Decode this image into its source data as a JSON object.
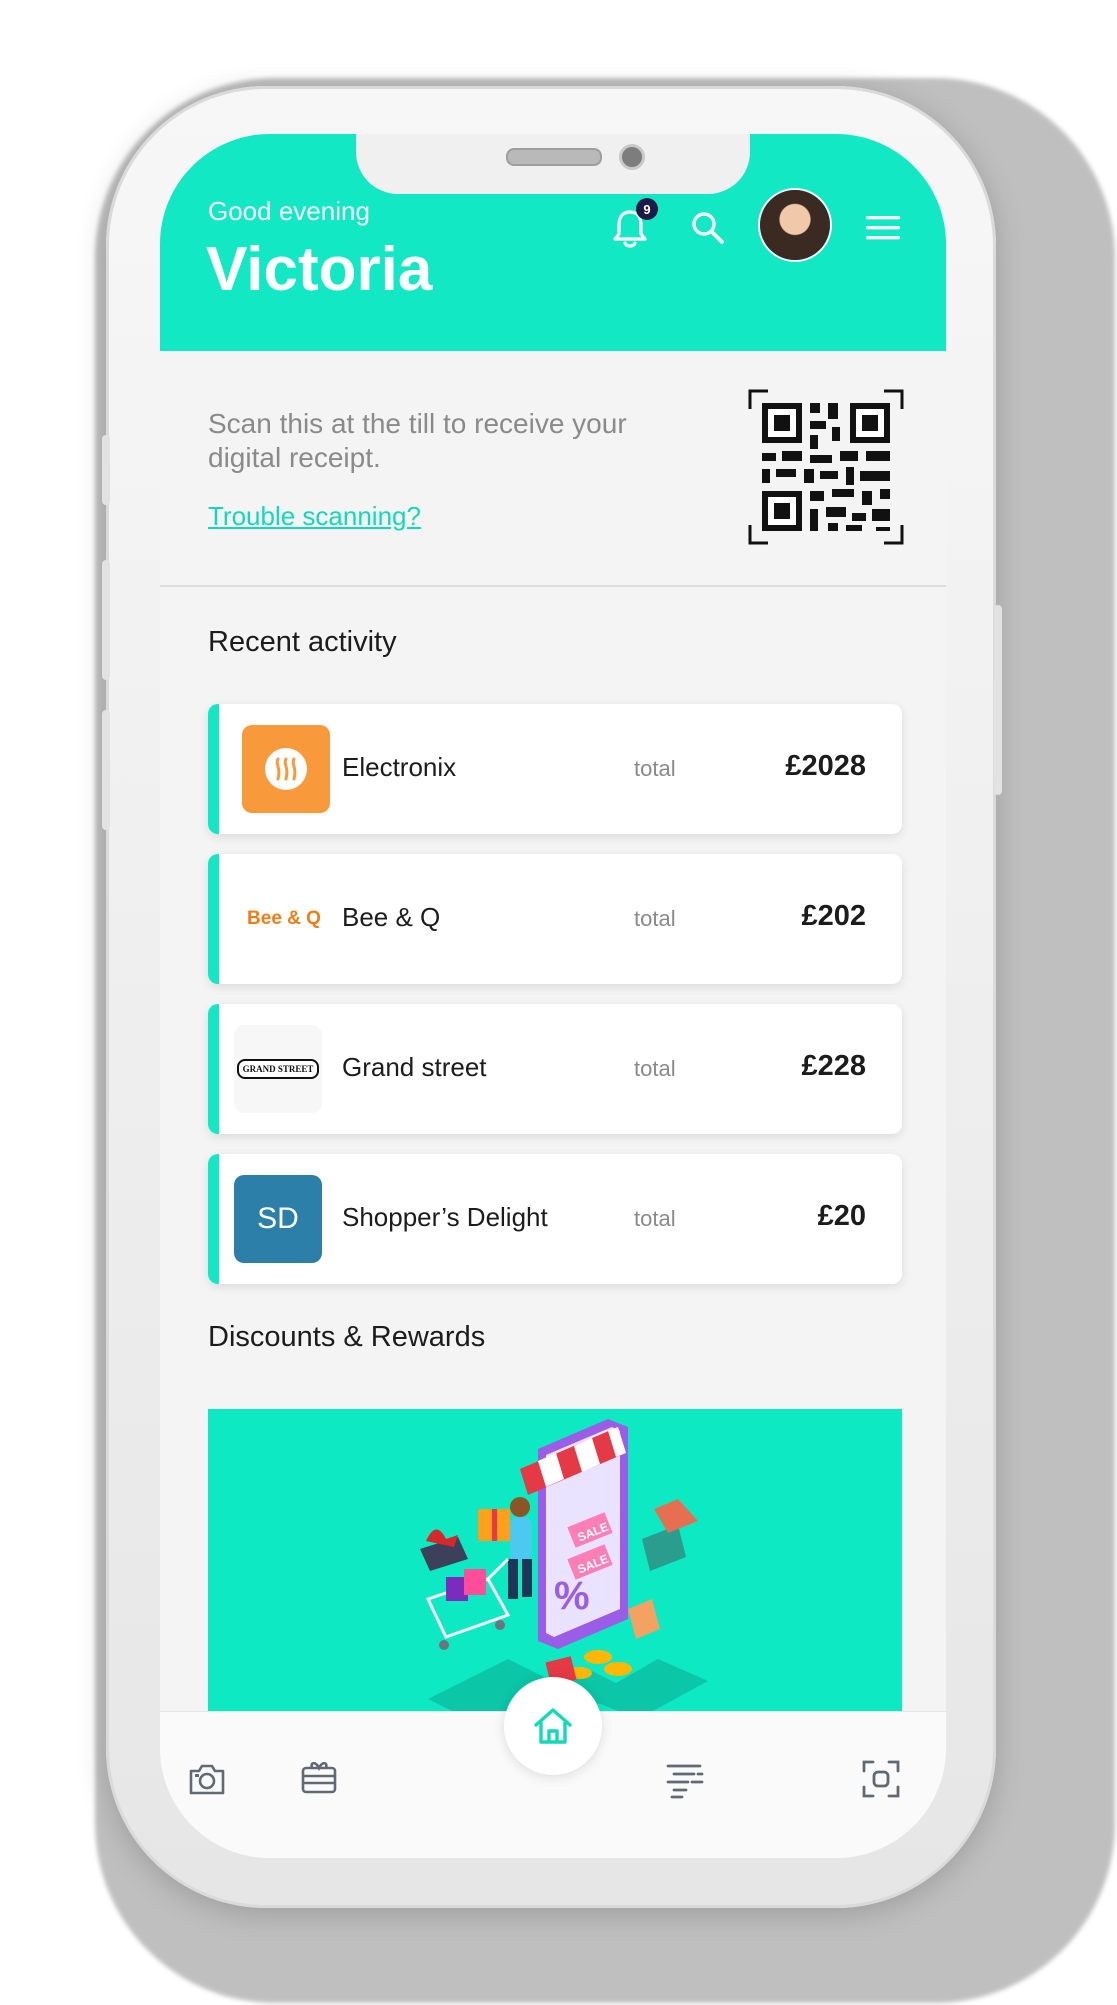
{
  "header": {
    "greeting": "Good evening",
    "username": "Victoria",
    "notification_count": "9",
    "accent_color": "#12e8c4"
  },
  "qr": {
    "instruction": "Scan this at the till to receive your digital receipt.",
    "help_link": "Trouble scanning?"
  },
  "recent_activity": {
    "title": "Recent activity",
    "items": [
      {
        "merchant": "Electronix",
        "total_label": "total",
        "amount": "£2028",
        "logo": "electronix-logo"
      },
      {
        "merchant": "Bee & Q",
        "total_label": "total",
        "amount": "£202",
        "logo_text": "Bee & Q"
      },
      {
        "merchant": "Grand street",
        "total_label": "total",
        "amount": "£228",
        "logo_text": "GRAND STREET"
      },
      {
        "merchant": "Shopper’s Delight",
        "total_label": "total",
        "amount": "£20",
        "logo_text": "SD"
      }
    ]
  },
  "discounts": {
    "title": "Discounts & Rewards",
    "banner_signs": [
      "SALE",
      "SALE",
      "%"
    ]
  },
  "bottom_nav": {
    "items": [
      "camera-icon",
      "gift-card-icon",
      "home-icon",
      "receipts-list-icon",
      "scan-icon"
    ]
  }
}
